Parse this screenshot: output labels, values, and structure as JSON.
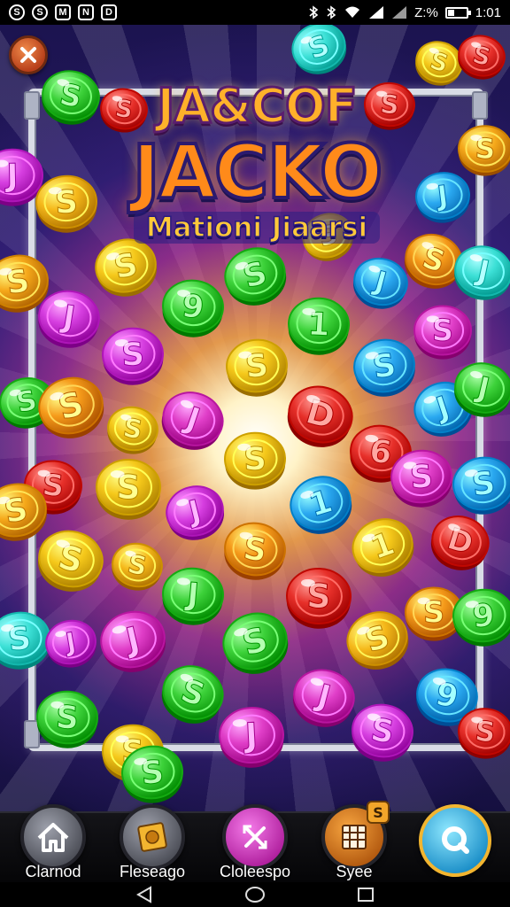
{
  "status_bar": {
    "left_icons": [
      "S",
      "S",
      "M",
      "N",
      "D"
    ],
    "icons": [
      "bluetooth-icon",
      "wifi-icon",
      "signal-icon"
    ],
    "battery_text": "Z:%",
    "battery_level": 0.35,
    "time": "1:01"
  },
  "game": {
    "title_line1": "JA&COF",
    "title_line2": "JACKO",
    "title_line3": "Mationi Jiaarsi",
    "close_icon": "close-icon"
  },
  "coins": [
    {
      "c": "#3ce0d6",
      "g": "S"
    },
    {
      "c": "#f5c81a",
      "g": "S"
    },
    {
      "c": "#e7302a",
      "g": "S"
    },
    {
      "c": "#3dd23a",
      "g": "S"
    },
    {
      "c": "#e7302a",
      "g": "S"
    },
    {
      "c": "#e7302a",
      "g": "S"
    },
    {
      "c": "#f5a81a",
      "g": "S"
    },
    {
      "c": "#d63ee0",
      "g": "J"
    },
    {
      "c": "#f5b81a",
      "g": "S"
    },
    {
      "c": "#2aa8f0",
      "g": "J"
    },
    {
      "c": "#f5a81a",
      "g": "S"
    },
    {
      "c": "#f5c81a",
      "g": "S"
    },
    {
      "c": "#3dd23a",
      "g": "S"
    },
    {
      "c": "#f5c81a",
      "g": "S"
    },
    {
      "c": "#f59a1a",
      "g": "S"
    },
    {
      "c": "#2aa8f0",
      "g": "J"
    },
    {
      "c": "#3ce0d6",
      "g": "J"
    },
    {
      "c": "#d63ee0",
      "g": "J"
    },
    {
      "c": "#3dd23a",
      "g": "9"
    },
    {
      "c": "#3dd23a",
      "g": "1"
    },
    {
      "c": "#e03ec8",
      "g": "S"
    },
    {
      "c": "#d63ee0",
      "g": "S"
    },
    {
      "c": "#f5c81a",
      "g": "S"
    },
    {
      "c": "#2aa8f0",
      "g": "S"
    },
    {
      "c": "#3dd23a",
      "g": "S"
    },
    {
      "c": "#f59a1a",
      "g": "S"
    },
    {
      "c": "#2aa8f0",
      "g": "J"
    },
    {
      "c": "#e03ec8",
      "g": "J"
    },
    {
      "c": "#e7302a",
      "g": "D"
    },
    {
      "c": "#3dd23a",
      "g": "J"
    },
    {
      "c": "#f5c81a",
      "g": "S"
    },
    {
      "c": "#e7302a",
      "g": "6"
    },
    {
      "c": "#e7302a",
      "g": "S"
    },
    {
      "c": "#f5c81a",
      "g": "S"
    },
    {
      "c": "#f5c81a",
      "g": "S"
    },
    {
      "c": "#e03ec8",
      "g": "S"
    },
    {
      "c": "#2aa8f0",
      "g": "S"
    },
    {
      "c": "#f5a81a",
      "g": "S"
    },
    {
      "c": "#d63ee0",
      "g": "J"
    },
    {
      "c": "#2aa8f0",
      "g": "1"
    },
    {
      "c": "#f5c81a",
      "g": "1"
    },
    {
      "c": "#e7302a",
      "g": "D"
    },
    {
      "c": "#f5c81a",
      "g": "S"
    },
    {
      "c": "#f5b81a",
      "g": "S"
    },
    {
      "c": "#f59a1a",
      "g": "S"
    },
    {
      "c": "#3dd23a",
      "g": "J"
    },
    {
      "c": "#e7302a",
      "g": "S"
    },
    {
      "c": "#f59a1a",
      "g": "S"
    },
    {
      "c": "#3dd23a",
      "g": "9"
    },
    {
      "c": "#3ce0d6",
      "g": "S"
    },
    {
      "c": "#d63ee0",
      "g": "J"
    },
    {
      "c": "#e03ec8",
      "g": "J"
    },
    {
      "c": "#3dd23a",
      "g": "S"
    },
    {
      "c": "#f5b81a",
      "g": "S"
    },
    {
      "c": "#3dd23a",
      "g": "S"
    },
    {
      "c": "#e03ec8",
      "g": "J"
    },
    {
      "c": "#2aa8f0",
      "g": "9"
    },
    {
      "c": "#d63ee0",
      "g": "S"
    },
    {
      "c": "#e7302a",
      "g": "S"
    },
    {
      "c": "#3dd23a",
      "g": "S"
    },
    {
      "c": "#f5c81a",
      "g": "S"
    },
    {
      "c": "#e03ec8",
      "g": "J"
    },
    {
      "c": "#3dd23a",
      "g": "S"
    }
  ],
  "bottom_nav": [
    {
      "label": "Clarnod",
      "icon": "home-icon",
      "color": "#6a6d78"
    },
    {
      "label": "Fleseago",
      "icon": "ticket-icon",
      "color": "#6a6d78"
    },
    {
      "label": "Cloleespo",
      "icon": "cross-arrows-icon",
      "color": "#e03ec8"
    },
    {
      "label": "Syee",
      "icon": "grid-card-icon",
      "color": "#e8801a",
      "badge": "S"
    },
    {
      "label": "",
      "icon": "search-icon",
      "color": "#38c0e8"
    }
  ],
  "system_nav": [
    "back-icon",
    "home-circle-icon",
    "recents-icon"
  ]
}
